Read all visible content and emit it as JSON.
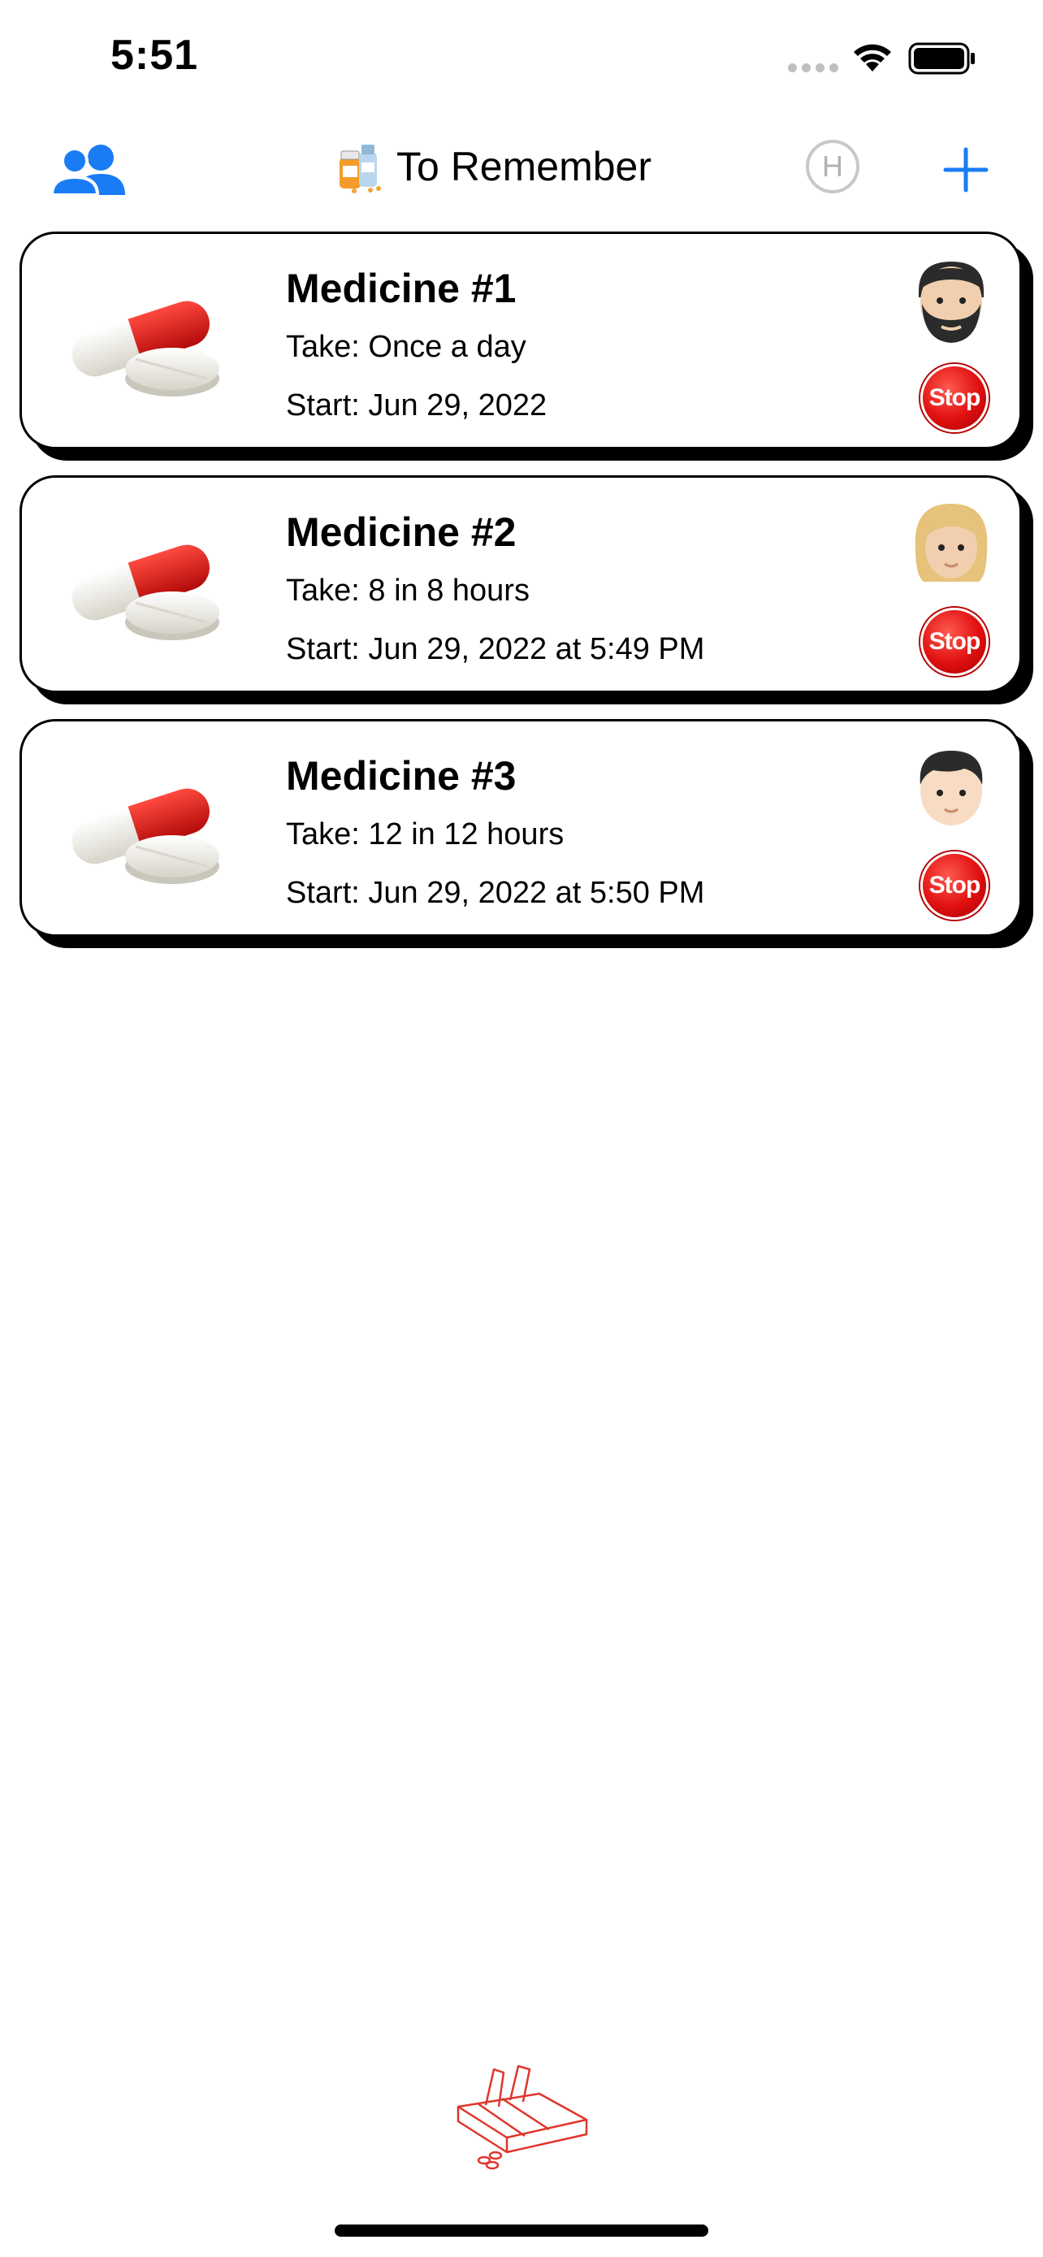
{
  "status_bar": {
    "time": "5:51",
    "signal_icon": "cellular-signal-icon",
    "wifi_icon": "wifi-icon",
    "battery_icon": "battery-icon"
  },
  "nav": {
    "left_icon": "people-icon",
    "title_icon": "medicine-bottles-icon",
    "title": "To Remember",
    "h_label": "H",
    "add_icon": "plus-icon",
    "accent_color": "#1a7cf5"
  },
  "medicines": [
    {
      "name": "Medicine #1",
      "take": "Take: Once a day",
      "start": "Start: Jun 29, 2022",
      "avatar": "man-beard-avatar",
      "stop_label": "Stop"
    },
    {
      "name": "Medicine #2",
      "take": "Take: 8 in 8 hours",
      "start": "Start: Jun 29, 2022 at 5:49 PM",
      "avatar": "woman-blonde-avatar",
      "stop_label": "Stop"
    },
    {
      "name": "Medicine #3",
      "take": "Take: 12 in 12 hours",
      "start": "Start: Jun 29, 2022 at 5:50 PM",
      "avatar": "boy-avatar",
      "stop_label": "Stop"
    }
  ],
  "footer": {
    "logo_icon": "pill-organizer-icon",
    "logo_color": "#e0352b"
  }
}
